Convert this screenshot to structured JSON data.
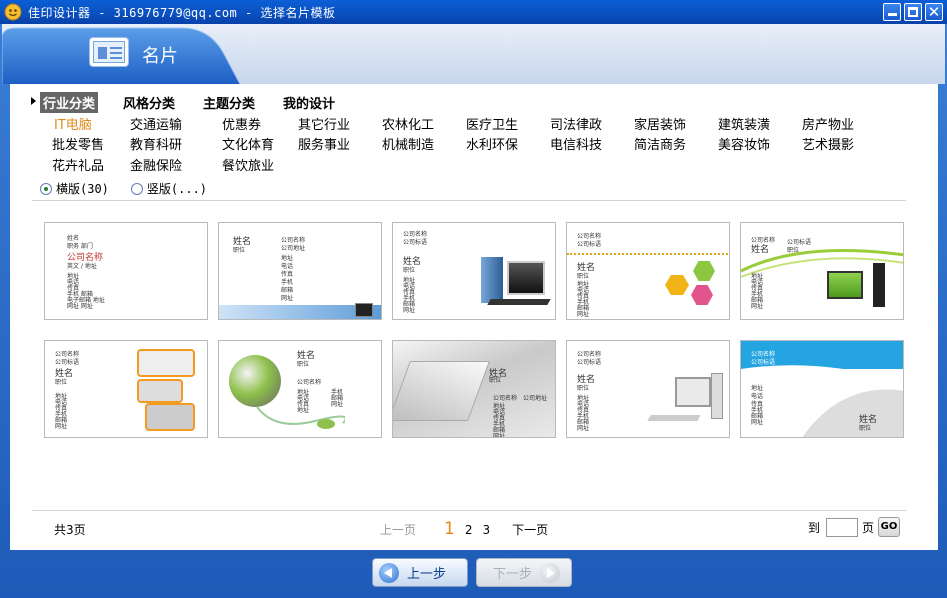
{
  "window": {
    "title": "佳印设计器 - 316976779@qq.com - 选择名片模板"
  },
  "header": {
    "title": "名片"
  },
  "category_tabs": [
    {
      "label": "行业分类",
      "active": true
    },
    {
      "label": "风格分类",
      "active": false
    },
    {
      "label": "主题分类",
      "active": false
    },
    {
      "label": "我的设计",
      "active": false
    }
  ],
  "categories": [
    [
      "IT电脑",
      "交通运输",
      "优惠券",
      "其它行业",
      "农林化工",
      "医疗卫生",
      "司法律政",
      "家居装饰",
      "建筑装潢",
      "房产物业"
    ],
    [
      "批发零售",
      "教育科研",
      "文化体育",
      "服务事业",
      "机械制造",
      "水利环保",
      "电信科技",
      "简洁商务",
      "美容妆饰",
      "艺术摄影"
    ],
    [
      "花卉礼品",
      "金融保险",
      "餐饮旅业"
    ]
  ],
  "active_category": "IT电脑",
  "orientation": {
    "landscape": "横版(30)",
    "portrait": "竖版(...)",
    "selected": "landscape"
  },
  "templates": [
    {
      "lines": [
        "姓名",
        "职务 部门",
        "公司名称",
        "英文 / 地址",
        "地址",
        "电话",
        "传真",
        "手机 邮箱",
        "电子邮箱 地址",
        "网址 网址"
      ]
    },
    {
      "lines": [
        "姓名",
        "职位",
        "公司名称",
        "公司地址",
        "地址",
        "电话",
        "传真",
        "手机",
        "邮箱",
        "网址"
      ]
    },
    {
      "lines": [
        "公司名称",
        "公司标语",
        "姓名",
        "职位",
        "地址",
        "电话",
        "传真",
        "手机",
        "邮箱",
        "网址"
      ]
    },
    {
      "lines": [
        "公司名称",
        "公司标语",
        "姓名",
        "职位",
        "地址",
        "电话",
        "传真",
        "手机",
        "邮箱",
        "网址"
      ]
    },
    {
      "lines": [
        "公司名称",
        "公司标语",
        "姓名",
        "职位",
        "地址",
        "电话",
        "传真",
        "手机",
        "邮箱",
        "网址"
      ]
    },
    {
      "lines": [
        "公司名称",
        "公司标语",
        "姓名",
        "职位",
        "地址",
        "电话",
        "传真",
        "手机",
        "邮箱",
        "网址"
      ]
    },
    {
      "lines": [
        "姓名",
        "职位",
        "公司名称",
        "地址",
        "电话",
        "传真",
        "手机",
        "邮箱",
        "网址",
        "地址"
      ]
    },
    {
      "lines": [
        "姓名",
        "职位",
        "公司名称",
        "地址",
        "电话",
        "传真",
        "手机",
        "邮箱",
        "网址",
        "公司地址"
      ]
    },
    {
      "lines": [
        "公司名称",
        "公司标语",
        "姓名",
        "职位",
        "地址",
        "电话",
        "传真",
        "手机",
        "邮箱",
        "网址"
      ]
    },
    {
      "lines": [
        "公司名称",
        "公司标语",
        "地址",
        "电话",
        "传真",
        "手机",
        "邮箱",
        "网址",
        "姓名",
        "职位"
      ]
    }
  ],
  "pager": {
    "total": "共3页",
    "prev": "上一页",
    "pages": [
      "1",
      "2",
      "3"
    ],
    "current": "1",
    "next": "下一页",
    "goto_label": "到",
    "page_unit": "页",
    "go": "GO",
    "goto_value": ""
  },
  "footer": {
    "prev_step": "上一步",
    "next_step": "下一步"
  },
  "colors": {
    "accent": "#e08a1e",
    "title_bar": "#0a4fbf",
    "frame": "#2f6fc6"
  }
}
